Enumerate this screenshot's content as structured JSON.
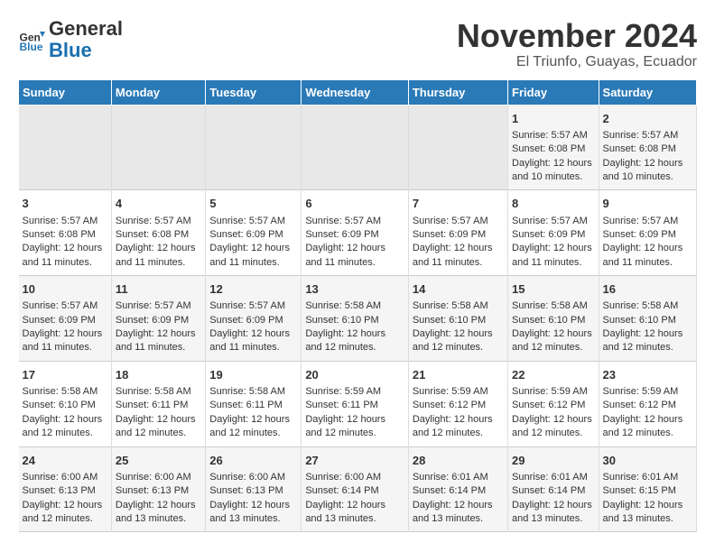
{
  "logo": {
    "general": "General",
    "blue": "Blue"
  },
  "header": {
    "month": "November 2024",
    "location": "El Triunfo, Guayas, Ecuador"
  },
  "weekdays": [
    "Sunday",
    "Monday",
    "Tuesday",
    "Wednesday",
    "Thursday",
    "Friday",
    "Saturday"
  ],
  "weeks": [
    [
      {
        "day": "",
        "sunrise": "",
        "sunset": "",
        "daylight": "",
        "empty": true
      },
      {
        "day": "",
        "sunrise": "",
        "sunset": "",
        "daylight": "",
        "empty": true
      },
      {
        "day": "",
        "sunrise": "",
        "sunset": "",
        "daylight": "",
        "empty": true
      },
      {
        "day": "",
        "sunrise": "",
        "sunset": "",
        "daylight": "",
        "empty": true
      },
      {
        "day": "",
        "sunrise": "",
        "sunset": "",
        "daylight": "",
        "empty": true
      },
      {
        "day": "1",
        "sunrise": "Sunrise: 5:57 AM",
        "sunset": "Sunset: 6:08 PM",
        "daylight": "Daylight: 12 hours and 10 minutes.",
        "empty": false
      },
      {
        "day": "2",
        "sunrise": "Sunrise: 5:57 AM",
        "sunset": "Sunset: 6:08 PM",
        "daylight": "Daylight: 12 hours and 10 minutes.",
        "empty": false
      }
    ],
    [
      {
        "day": "3",
        "sunrise": "Sunrise: 5:57 AM",
        "sunset": "Sunset: 6:08 PM",
        "daylight": "Daylight: 12 hours and 11 minutes.",
        "empty": false
      },
      {
        "day": "4",
        "sunrise": "Sunrise: 5:57 AM",
        "sunset": "Sunset: 6:08 PM",
        "daylight": "Daylight: 12 hours and 11 minutes.",
        "empty": false
      },
      {
        "day": "5",
        "sunrise": "Sunrise: 5:57 AM",
        "sunset": "Sunset: 6:09 PM",
        "daylight": "Daylight: 12 hours and 11 minutes.",
        "empty": false
      },
      {
        "day": "6",
        "sunrise": "Sunrise: 5:57 AM",
        "sunset": "Sunset: 6:09 PM",
        "daylight": "Daylight: 12 hours and 11 minutes.",
        "empty": false
      },
      {
        "day": "7",
        "sunrise": "Sunrise: 5:57 AM",
        "sunset": "Sunset: 6:09 PM",
        "daylight": "Daylight: 12 hours and 11 minutes.",
        "empty": false
      },
      {
        "day": "8",
        "sunrise": "Sunrise: 5:57 AM",
        "sunset": "Sunset: 6:09 PM",
        "daylight": "Daylight: 12 hours and 11 minutes.",
        "empty": false
      },
      {
        "day": "9",
        "sunrise": "Sunrise: 5:57 AM",
        "sunset": "Sunset: 6:09 PM",
        "daylight": "Daylight: 12 hours and 11 minutes.",
        "empty": false
      }
    ],
    [
      {
        "day": "10",
        "sunrise": "Sunrise: 5:57 AM",
        "sunset": "Sunset: 6:09 PM",
        "daylight": "Daylight: 12 hours and 11 minutes.",
        "empty": false
      },
      {
        "day": "11",
        "sunrise": "Sunrise: 5:57 AM",
        "sunset": "Sunset: 6:09 PM",
        "daylight": "Daylight: 12 hours and 11 minutes.",
        "empty": false
      },
      {
        "day": "12",
        "sunrise": "Sunrise: 5:57 AM",
        "sunset": "Sunset: 6:09 PM",
        "daylight": "Daylight: 12 hours and 11 minutes.",
        "empty": false
      },
      {
        "day": "13",
        "sunrise": "Sunrise: 5:58 AM",
        "sunset": "Sunset: 6:10 PM",
        "daylight": "Daylight: 12 hours and 12 minutes.",
        "empty": false
      },
      {
        "day": "14",
        "sunrise": "Sunrise: 5:58 AM",
        "sunset": "Sunset: 6:10 PM",
        "daylight": "Daylight: 12 hours and 12 minutes.",
        "empty": false
      },
      {
        "day": "15",
        "sunrise": "Sunrise: 5:58 AM",
        "sunset": "Sunset: 6:10 PM",
        "daylight": "Daylight: 12 hours and 12 minutes.",
        "empty": false
      },
      {
        "day": "16",
        "sunrise": "Sunrise: 5:58 AM",
        "sunset": "Sunset: 6:10 PM",
        "daylight": "Daylight: 12 hours and 12 minutes.",
        "empty": false
      }
    ],
    [
      {
        "day": "17",
        "sunrise": "Sunrise: 5:58 AM",
        "sunset": "Sunset: 6:10 PM",
        "daylight": "Daylight: 12 hours and 12 minutes.",
        "empty": false
      },
      {
        "day": "18",
        "sunrise": "Sunrise: 5:58 AM",
        "sunset": "Sunset: 6:11 PM",
        "daylight": "Daylight: 12 hours and 12 minutes.",
        "empty": false
      },
      {
        "day": "19",
        "sunrise": "Sunrise: 5:58 AM",
        "sunset": "Sunset: 6:11 PM",
        "daylight": "Daylight: 12 hours and 12 minutes.",
        "empty": false
      },
      {
        "day": "20",
        "sunrise": "Sunrise: 5:59 AM",
        "sunset": "Sunset: 6:11 PM",
        "daylight": "Daylight: 12 hours and 12 minutes.",
        "empty": false
      },
      {
        "day": "21",
        "sunrise": "Sunrise: 5:59 AM",
        "sunset": "Sunset: 6:12 PM",
        "daylight": "Daylight: 12 hours and 12 minutes.",
        "empty": false
      },
      {
        "day": "22",
        "sunrise": "Sunrise: 5:59 AM",
        "sunset": "Sunset: 6:12 PM",
        "daylight": "Daylight: 12 hours and 12 minutes.",
        "empty": false
      },
      {
        "day": "23",
        "sunrise": "Sunrise: 5:59 AM",
        "sunset": "Sunset: 6:12 PM",
        "daylight": "Daylight: 12 hours and 12 minutes.",
        "empty": false
      }
    ],
    [
      {
        "day": "24",
        "sunrise": "Sunrise: 6:00 AM",
        "sunset": "Sunset: 6:13 PM",
        "daylight": "Daylight: 12 hours and 12 minutes.",
        "empty": false
      },
      {
        "day": "25",
        "sunrise": "Sunrise: 6:00 AM",
        "sunset": "Sunset: 6:13 PM",
        "daylight": "Daylight: 12 hours and 13 minutes.",
        "empty": false
      },
      {
        "day": "26",
        "sunrise": "Sunrise: 6:00 AM",
        "sunset": "Sunset: 6:13 PM",
        "daylight": "Daylight: 12 hours and 13 minutes.",
        "empty": false
      },
      {
        "day": "27",
        "sunrise": "Sunrise: 6:00 AM",
        "sunset": "Sunset: 6:14 PM",
        "daylight": "Daylight: 12 hours and 13 minutes.",
        "empty": false
      },
      {
        "day": "28",
        "sunrise": "Sunrise: 6:01 AM",
        "sunset": "Sunset: 6:14 PM",
        "daylight": "Daylight: 12 hours and 13 minutes.",
        "empty": false
      },
      {
        "day": "29",
        "sunrise": "Sunrise: 6:01 AM",
        "sunset": "Sunset: 6:14 PM",
        "daylight": "Daylight: 12 hours and 13 minutes.",
        "empty": false
      },
      {
        "day": "30",
        "sunrise": "Sunrise: 6:01 AM",
        "sunset": "Sunset: 6:15 PM",
        "daylight": "Daylight: 12 hours and 13 minutes.",
        "empty": false
      }
    ]
  ]
}
